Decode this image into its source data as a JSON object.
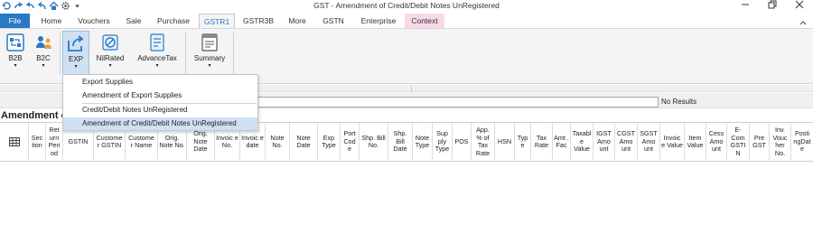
{
  "window": {
    "title": "GST - Amendment of Credit/Debit Notes UnRegistered"
  },
  "qat": [
    "refresh-icon",
    "redo-icon",
    "undo-icon",
    "undo-all-icon",
    "home-icon",
    "settings-icon",
    "qat-dropdown-icon"
  ],
  "tabs": [
    "File",
    "Home",
    "Vouchers",
    "Sale",
    "Purchase",
    "GSTR1",
    "GSTR3B",
    "More",
    "GSTN",
    "Enterprise",
    "Context"
  ],
  "active_tab": "GSTR1",
  "ribbon": {
    "b2b": "B2B",
    "b2c": "B2C",
    "exp": "EXP",
    "nilrated": "NilRated",
    "advancetax": "AdvanceTax",
    "summary": "Summary"
  },
  "dropdown": {
    "items": [
      "Export Supplies",
      "Amendment of Export Supplies",
      "Credit/Debit Notes UnRegistered",
      "Amendment of Credit/Debit Notes UnRegistered"
    ]
  },
  "search": {
    "status": "No Results"
  },
  "grid": {
    "title": "Amendment o",
    "columns": [
      "Sec tion",
      "Ret urn Peri od",
      "GSTIN",
      "Custome r GSTIN",
      "Custome r Name",
      "Orig. Note No.",
      "Orig. Note Date",
      "Invoic e No.",
      "Invoic e date",
      "Note No.",
      "Note Date",
      "Exp Type",
      "Port Cod e",
      "Shp. Bill No.",
      "Shp. Bill Date",
      "Note Type",
      "Sup ply Type",
      "POS",
      "App. % of Tax Rate",
      "HSN",
      "Typ e",
      "Tax Rate",
      "Amt . Fac",
      "Taxabl e Value",
      "IGST Amo unt",
      "CGST Amo unt",
      "SGST Amo unt",
      "Invoic e Value",
      "Item Value",
      "Cess Amo unt",
      "E- Com GSTI N",
      "Pre GST",
      "Inv. Vouc her No.",
      "Posti ngDat e"
    ]
  },
  "colors": {
    "accent": "#2b78c6",
    "context_tab": "#f8d9e8",
    "highlight": "#cfe0f2"
  }
}
